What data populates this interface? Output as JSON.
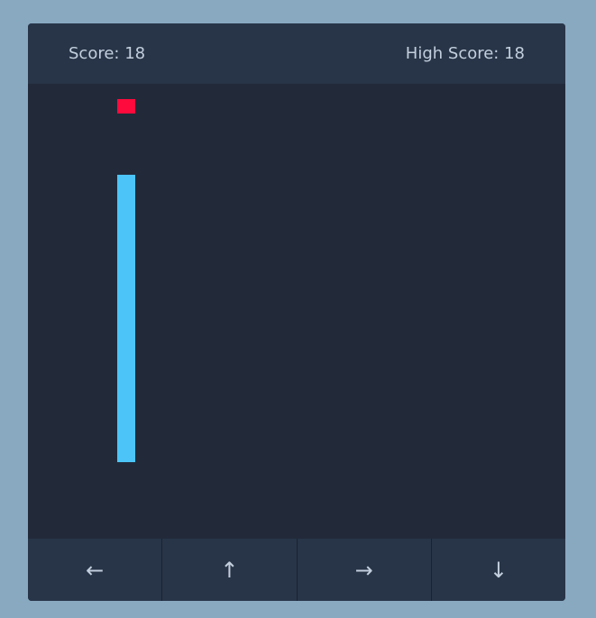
{
  "score_bar": {
    "score_text": "Score: 18",
    "high_score_text": "High Score: 18"
  },
  "board": {
    "colors": {
      "background": "#222a3a",
      "snake": "#4cc4f7",
      "food": "#ff0a3c"
    }
  },
  "controls": {
    "left": "←",
    "up": "↑",
    "right": "→",
    "down": "↓"
  }
}
